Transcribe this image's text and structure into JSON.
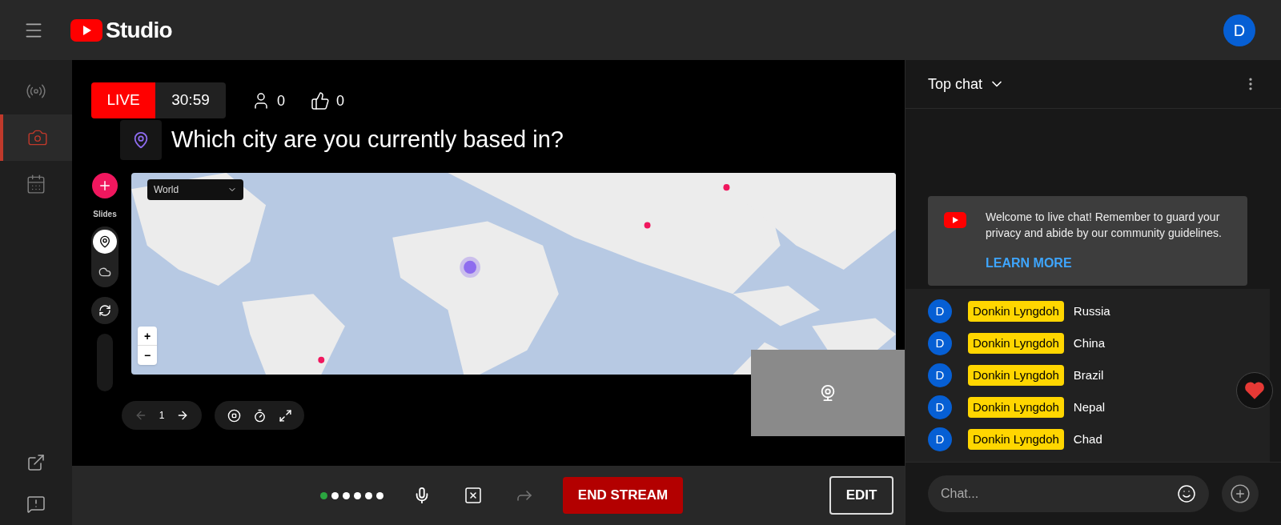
{
  "header": {
    "logo_text": "Studio",
    "avatar": "D"
  },
  "sidebar": {
    "items": [
      {
        "kind": "broadcast",
        "selected": false
      },
      {
        "kind": "camera",
        "selected": true
      },
      {
        "kind": "calendar",
        "selected": false
      }
    ]
  },
  "stream": {
    "live_label": "LIVE",
    "elapsed": "30:59",
    "viewers": "0",
    "likes": "0"
  },
  "poll": {
    "question": "Which city are you currently based in?"
  },
  "slides": {
    "label": "Slides",
    "items": [
      {
        "kind": "pin",
        "selected": true
      },
      {
        "kind": "cloud",
        "selected": false
      }
    ]
  },
  "map": {
    "region": "World",
    "zoom_in": "+",
    "zoom_out": "−"
  },
  "slide_nav": {
    "page": "1"
  },
  "chat": {
    "title": "Top chat",
    "welcome": "Welcome to live chat! Remember to guard your privacy and abide by our community guidelines.",
    "learn_more": "LEARN MORE",
    "messages": [
      {
        "avatar": "D",
        "author": "Donkin Lyngdoh",
        "text": "Russia"
      },
      {
        "avatar": "D",
        "author": "Donkin Lyngdoh",
        "text": "China"
      },
      {
        "avatar": "D",
        "author": "Donkin Lyngdoh",
        "text": "Brazil"
      },
      {
        "avatar": "D",
        "author": "Donkin Lyngdoh",
        "text": "Nepal"
      },
      {
        "avatar": "D",
        "author": "Donkin Lyngdoh",
        "text": "Chad"
      }
    ],
    "input": {
      "placeholder": "Chat..."
    }
  },
  "controls": {
    "end_stream": "END STREAM",
    "edit": "EDIT"
  }
}
